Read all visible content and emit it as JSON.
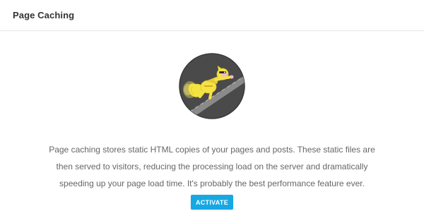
{
  "header": {
    "title": "Page Caching"
  },
  "illustration": {
    "icon": "superhero-squirrel-icon",
    "background_color": "#4a4a4a",
    "figure_color": "#f5e342"
  },
  "main": {
    "description": "Page caching stores static HTML copies of your pages and posts. These static files are then served to visitors, reducing the processing load on the server and dramatically speeding up your page load time. It's probably the best performance feature ever.",
    "activate_label": "ACTIVATE"
  },
  "colors": {
    "accent": "#17a8e3",
    "text": "#666666",
    "title": "#333333"
  }
}
